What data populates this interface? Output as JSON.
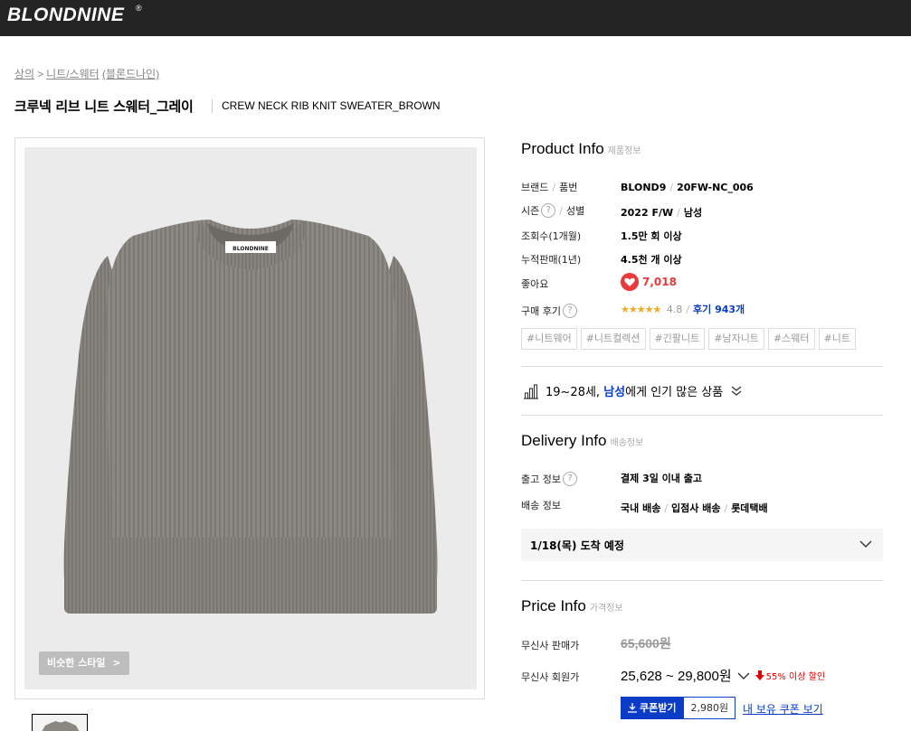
{
  "header": {
    "logo": "BLONDNINE",
    "logo_mark": "®"
  },
  "breadcrumb": {
    "items": [
      "상의",
      "니트/스웨터",
      "(블론드나인)"
    ],
    "separator": ">"
  },
  "product": {
    "title_ko": "크루넥 리브 니트 스웨터_그레이",
    "title_en": "CREW NECK RIB KNIT SWEATER_BROWN",
    "neck_label": "BLONDNINE",
    "similar_style_label": "비슷한 스타일",
    "sweater_color": "#8a8782"
  },
  "product_info": {
    "title": "Product Info",
    "subtitle": "제품정보",
    "rows": {
      "brand": {
        "label1": "브랜드",
        "label2": "품번",
        "value1": "BLOND9",
        "value2": "20FW-NC_006"
      },
      "season": {
        "label1": "시즌",
        "label2": "성별",
        "value1": "2022 F/W",
        "value2": "남성"
      },
      "views": {
        "label": "조회수(1개월)",
        "value": "1.5만 회 이상"
      },
      "sales": {
        "label": "누적판매(1년)",
        "value": "4.5천 개 이상"
      },
      "likes": {
        "label": "좋아요",
        "value": "7,018"
      },
      "reviews": {
        "label": "구매 후기",
        "stars": "★★★★★",
        "rating": "4.8",
        "count": "후기 943개"
      }
    },
    "tags": [
      "#니트웨어",
      "#니트컬렉션",
      "#긴팔니트",
      "#남자니트",
      "#스웨터",
      "#니트"
    ],
    "popular": {
      "age": "19~28세,",
      "gender": "남성",
      "suffix": "에게 인기 많은 상품"
    }
  },
  "delivery_info": {
    "title": "Delivery Info",
    "subtitle": "배송정보",
    "release": {
      "label": "출고 정보",
      "value": "결제 3일 이내 출고"
    },
    "shipping": {
      "label": "배송 정보",
      "values": [
        "국내 배송",
        "입점사 배송",
        "롯데택배"
      ]
    },
    "arrival": "1/18(목) 도착 예정"
  },
  "price_info": {
    "title": "Price Info",
    "subtitle": "가격정보",
    "sale": {
      "label": "무신사 판매가",
      "value": "65,600원"
    },
    "member": {
      "label": "무신사 회원가",
      "value": "25,628 ~ 29,800원",
      "discount": "55% 이상 할인"
    },
    "coupon": {
      "button": "쿠폰받기",
      "amount": "2,980원",
      "my_coupon": "내 보유 쿠폰 보기"
    }
  },
  "colors": {
    "accent": "#0a3cc7",
    "heart": "#e83a3a",
    "star": "#f5a623",
    "discount": "#e00000"
  }
}
